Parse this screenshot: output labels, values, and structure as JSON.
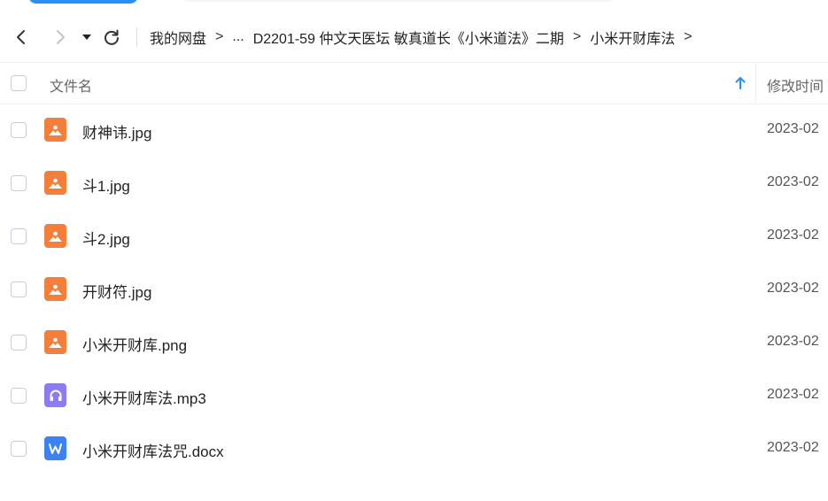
{
  "nav": {
    "back_icon": "chevron-left-icon",
    "forward_icon": "chevron-right-icon",
    "dropdown_icon": "caret-down-icon",
    "refresh_icon": "refresh-icon"
  },
  "breadcrumb": {
    "items": [
      "我的网盘",
      "...",
      "D2201-59 仲文天医坛 敏真道长《小米道法》二期",
      "小米开财库法"
    ],
    "separator": ">"
  },
  "header": {
    "file_name": "文件名",
    "modified_time": "修改时间",
    "sort_icon": "arrow-up-icon"
  },
  "files": [
    {
      "name": "财神讳.jpg",
      "type": "image",
      "icon": "image-file-icon",
      "date": "2023-02"
    },
    {
      "name": "斗1.jpg",
      "type": "image",
      "icon": "image-file-icon",
      "date": "2023-02"
    },
    {
      "name": "斗2.jpg",
      "type": "image",
      "icon": "image-file-icon",
      "date": "2023-02"
    },
    {
      "name": "开财符.jpg",
      "type": "image",
      "icon": "image-file-icon",
      "date": "2023-02"
    },
    {
      "name": "小米开财库.png",
      "type": "image",
      "icon": "image-file-icon",
      "date": "2023-02"
    },
    {
      "name": "小米开财库法.mp3",
      "type": "audio",
      "icon": "audio-file-icon",
      "date": "2023-02"
    },
    {
      "name": "小米开财库法咒.docx",
      "type": "word",
      "icon": "word-file-icon",
      "date": "2023-02"
    }
  ],
  "colors": {
    "image_icon": "#f57f3a",
    "audio_icon": "#8b7cf6",
    "word_icon": "#3b82f6",
    "accent": "#2b8ef3"
  }
}
